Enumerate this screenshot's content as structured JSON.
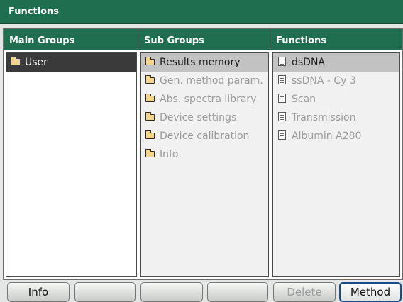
{
  "window": {
    "title": "Functions"
  },
  "main_groups": {
    "header": "Main Groups",
    "items": [
      {
        "label": "User",
        "icon": "folder-icon",
        "state": "selected"
      }
    ]
  },
  "sub_groups": {
    "header": "Sub Groups",
    "items": [
      {
        "label": "Results memory",
        "icon": "folder-icon",
        "state": "selected"
      },
      {
        "label": "Gen. method param.",
        "icon": "folder-icon",
        "state": "normal"
      },
      {
        "label": "Abs. spectra library",
        "icon": "folder-icon",
        "state": "normal"
      },
      {
        "label": "Device settings",
        "icon": "folder-icon",
        "state": "normal"
      },
      {
        "label": "Device calibration",
        "icon": "folder-icon",
        "state": "normal"
      },
      {
        "label": "Info",
        "icon": "folder-icon",
        "state": "normal"
      }
    ]
  },
  "functions": {
    "header": "Functions",
    "items": [
      {
        "label": "dsDNA",
        "icon": "document-icon",
        "state": "selected"
      },
      {
        "label": "ssDNA - Cy 3",
        "icon": "document-icon",
        "state": "normal"
      },
      {
        "label": "Scan",
        "icon": "document-icon",
        "state": "normal"
      },
      {
        "label": "Transmission",
        "icon": "document-icon",
        "state": "normal"
      },
      {
        "label": "Albumin A280",
        "icon": "document-icon",
        "state": "normal"
      }
    ]
  },
  "softkeys": {
    "key1": "Info",
    "key2": "",
    "key3": "",
    "key4": "",
    "key5": "Delete",
    "key6": "Method"
  },
  "colors": {
    "header_green": "#1f6e4f",
    "selected_dark": "#3a3a3a",
    "selected_light": "#c2c2c2",
    "disabled_text": "#9a9a9a"
  }
}
